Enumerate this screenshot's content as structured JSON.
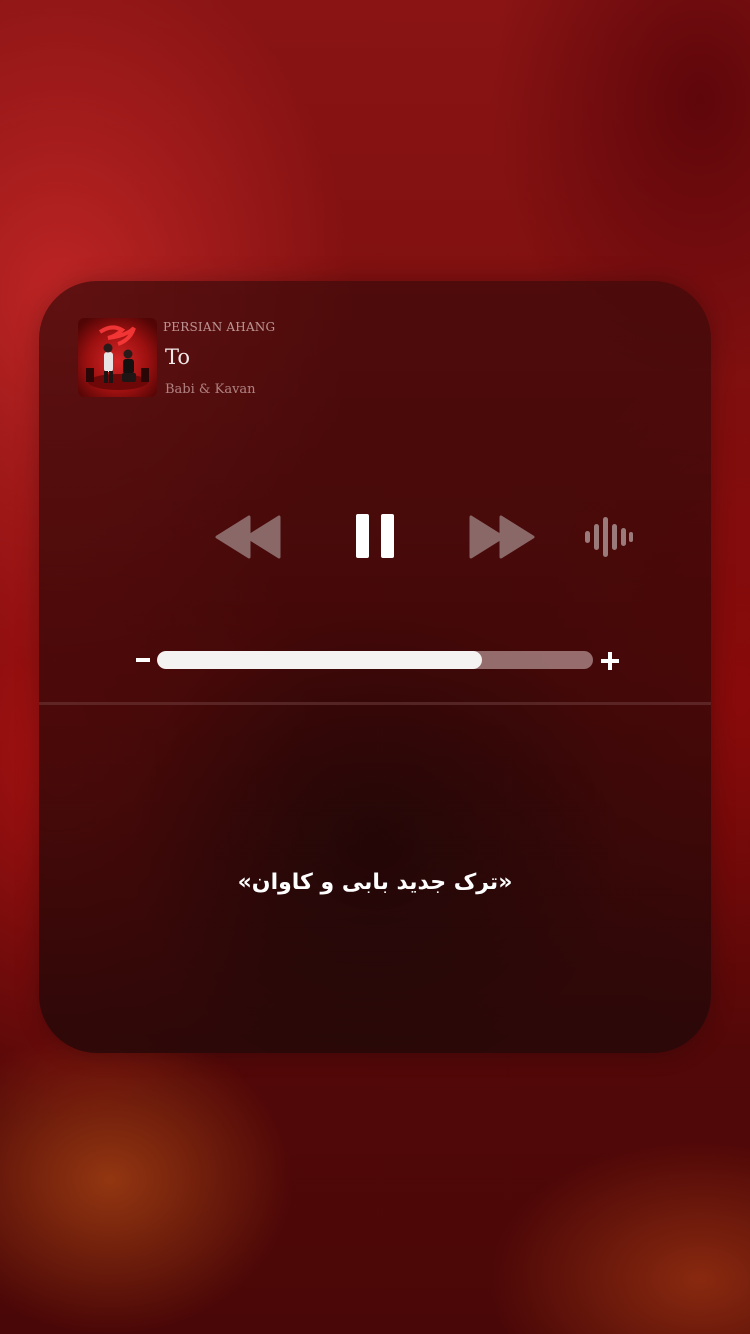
{
  "player": {
    "source": "PERSIAN AHANG",
    "title": "To",
    "artist": "Babi & Kavan",
    "volume_fraction": 0.745,
    "controls": {
      "rewind_icon": "rewind-icon",
      "pause_icon": "pause-icon",
      "forward_icon": "fast-forward-icon",
      "audio_icon": "audio-waveform-icon",
      "volume_down_icon": "minus-icon",
      "volume_up_icon": "plus-icon"
    }
  },
  "caption": "«ترک جدید بابی و کاوان»",
  "colors": {
    "background": "#7a0d0d",
    "card": "#3c0a0a",
    "control_dim": "#8a6a6a",
    "control_active": "#ffffff",
    "track": "#c8aaaa"
  }
}
